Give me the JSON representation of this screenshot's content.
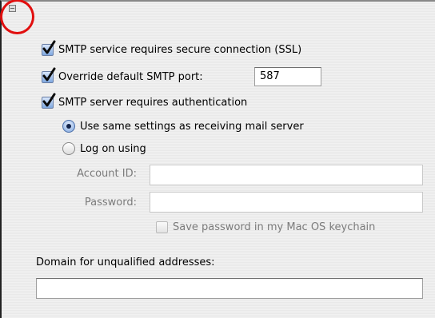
{
  "ssl": {
    "label": "SMTP service requires secure connection (SSL)",
    "checked": true
  },
  "port": {
    "label": "Override default SMTP port:",
    "checked": true,
    "value": "587"
  },
  "auth": {
    "label": "SMTP server requires authentication",
    "checked": true
  },
  "auth_options": {
    "same_settings": {
      "label": "Use same settings as receiving mail server",
      "selected": true
    },
    "log_on": {
      "label": "Log on using",
      "selected": false
    }
  },
  "account_id": {
    "label": "Account ID:",
    "value": ""
  },
  "password": {
    "label": "Password:",
    "value": ""
  },
  "keychain": {
    "label": "Save password in my Mac OS keychain",
    "checked": false
  },
  "domain": {
    "label": "Domain for unqualified addresses:",
    "value": ""
  },
  "colors": {
    "highlight_circle": "#e10f0f",
    "checkbox_fill": "#7ea8e0"
  }
}
